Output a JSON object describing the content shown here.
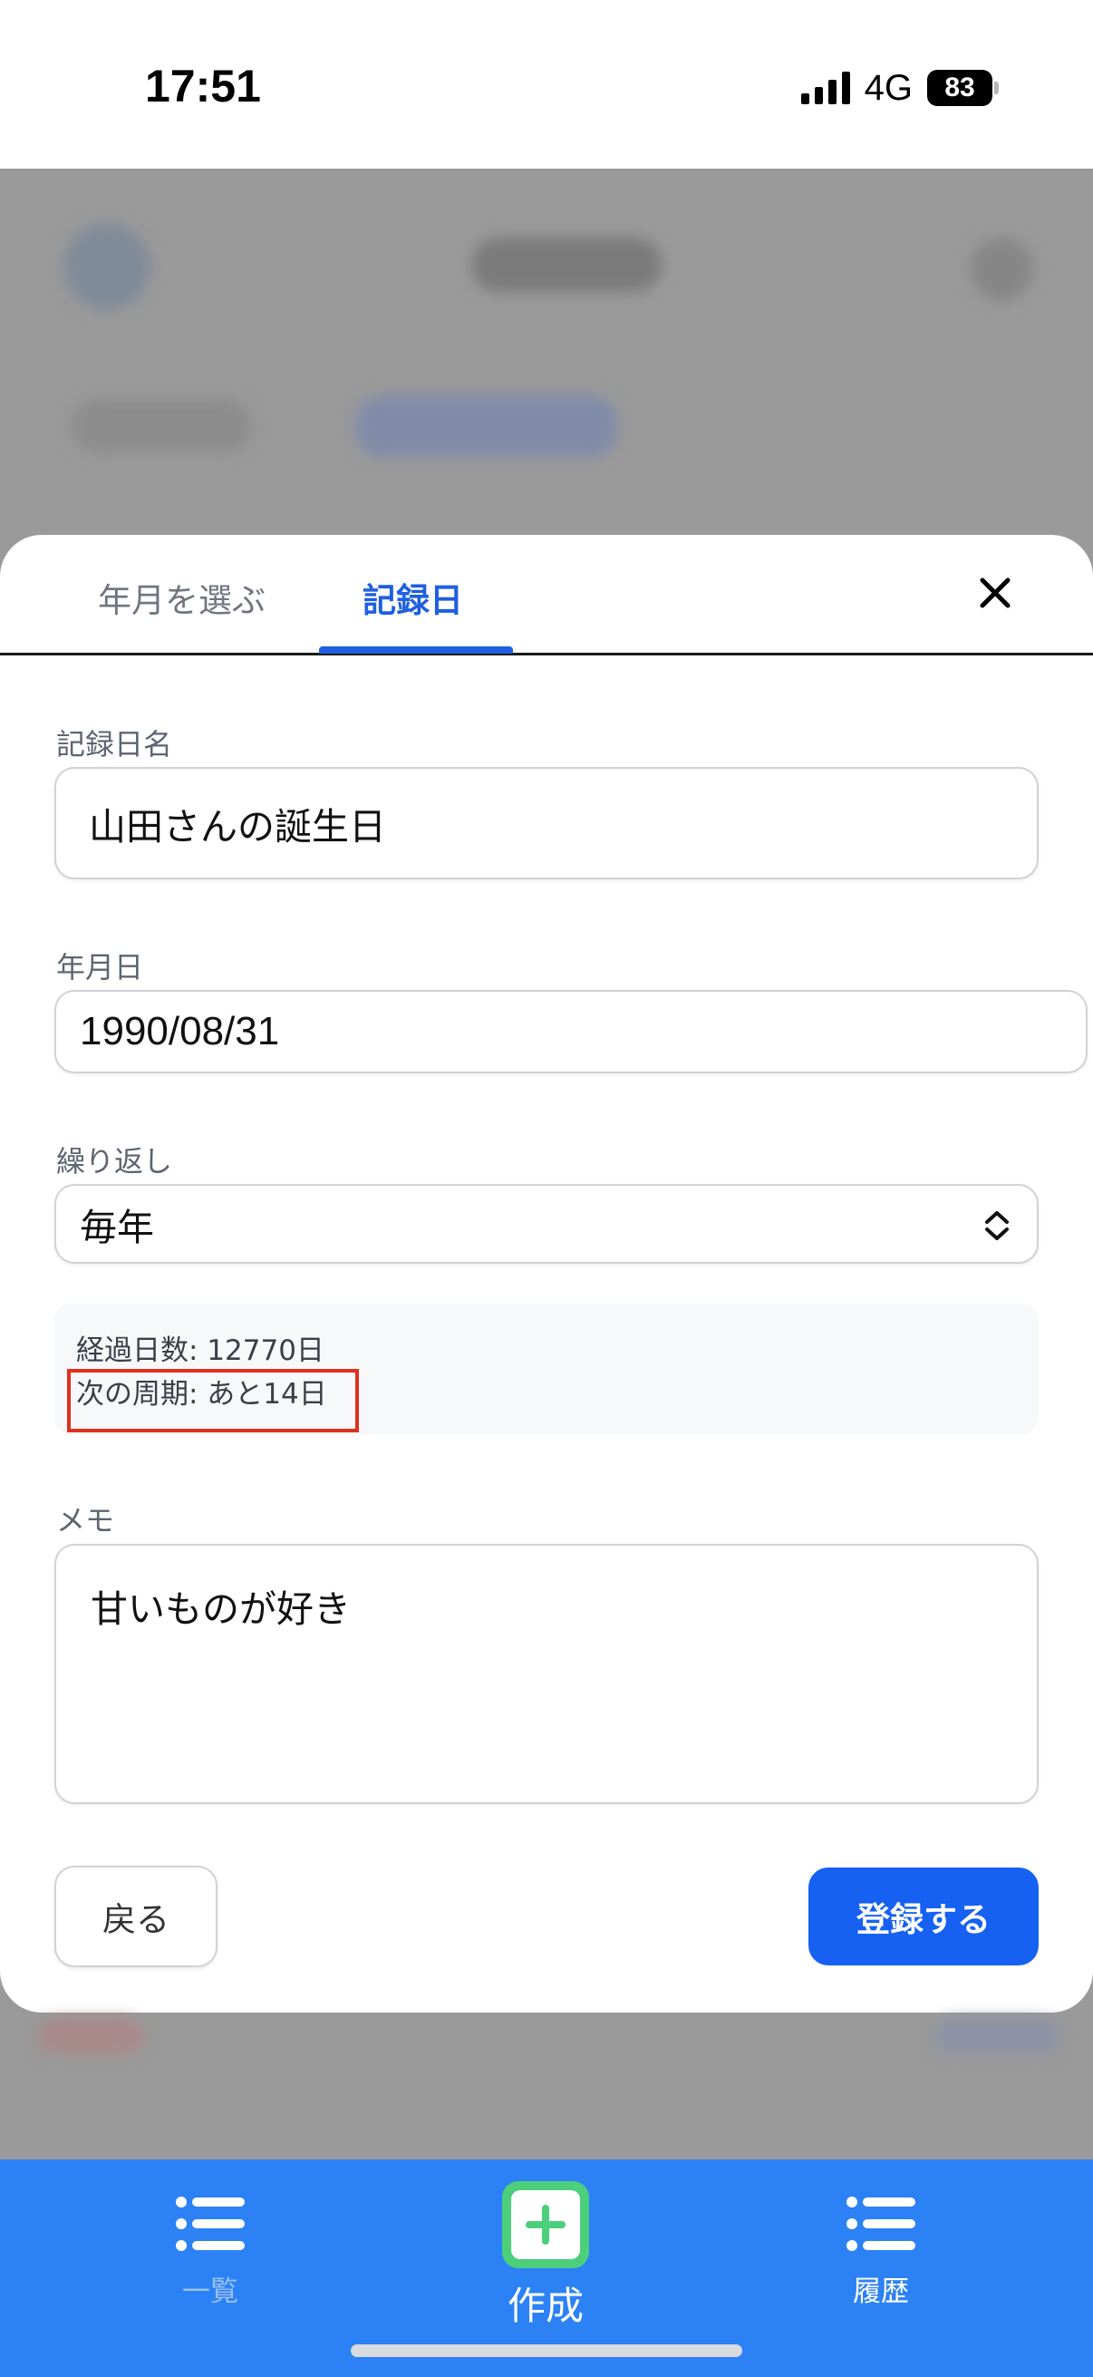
{
  "status_bar": {
    "time": "17:51",
    "network": "4G",
    "battery": "83"
  },
  "tabs": [
    {
      "label": "年月を選ぶ",
      "active": false
    },
    {
      "label": "記録日",
      "active": true
    }
  ],
  "form": {
    "name_label": "記録日名",
    "name_value": "山田さんの誕生日",
    "date_label": "年月日",
    "date_value": "1990/08/31",
    "repeat_label": "繰り返し",
    "repeat_value": "毎年",
    "info": {
      "elapsed": "経過日数: 12770日",
      "next_cycle": "次の周期: あと14日"
    },
    "memo_label": "メモ",
    "memo_value": "甘いものが好き"
  },
  "buttons": {
    "back": "戻る",
    "submit": "登録する"
  },
  "bottom_nav": [
    {
      "label": "一覧",
      "icon": "list-icon"
    },
    {
      "label": "作成",
      "icon": "plus-icon"
    },
    {
      "label": "履歴",
      "icon": "list-icon"
    }
  ],
  "colors": {
    "accent": "#1f5fe0",
    "primary_button": "#1661f2",
    "nav_background": "#2c82f5",
    "create_icon": "#4ccf7a",
    "highlight": "#e0301e"
  }
}
